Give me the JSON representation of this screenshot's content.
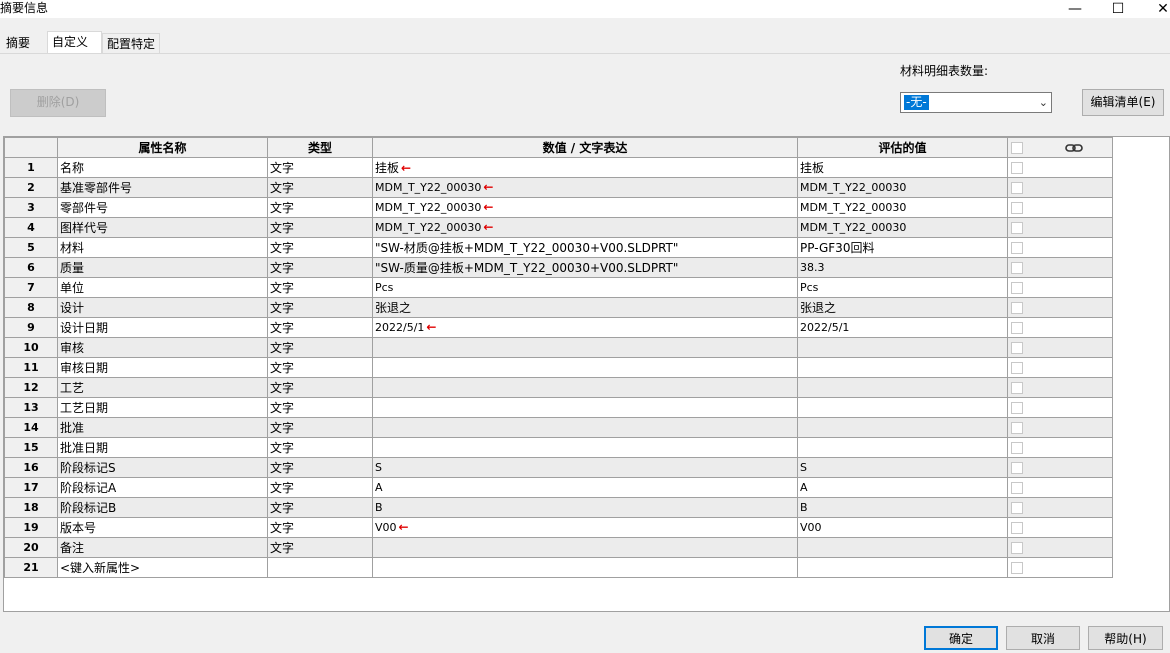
{
  "window": {
    "title": "摘要信息",
    "min": "—",
    "max": "☐",
    "close": "✕"
  },
  "tabs": [
    "摘要",
    "自定义",
    "配置特定"
  ],
  "toolbar": {
    "delete_label": "删除(D)",
    "bom_label": "材料明细表数量:",
    "bom_value": "-无-",
    "edit_list_label": "编辑清单(E)"
  },
  "table": {
    "headers": [
      "属性名称",
      "类型",
      "数值 / 文字表达",
      "评估的值"
    ],
    "link_icon": "link-icon",
    "rows": [
      {
        "num": "1",
        "name": "名称",
        "type": "文字",
        "value": "挂板",
        "eval": "挂板",
        "arrow": true
      },
      {
        "num": "2",
        "name": "基准零部件号",
        "type": "文字",
        "value": "MDM_T_Y22_00030",
        "eval": "MDM_T_Y22_00030",
        "arrow": true
      },
      {
        "num": "3",
        "name": "零部件号",
        "type": "文字",
        "value": "MDM_T_Y22_00030",
        "eval": "MDM_T_Y22_00030",
        "arrow": true
      },
      {
        "num": "4",
        "name": "图样代号",
        "type": "文字",
        "value": "MDM_T_Y22_00030",
        "eval": "MDM_T_Y22_00030",
        "arrow": true
      },
      {
        "num": "5",
        "name": "材料",
        "type": "文字",
        "value": "\"SW-材质@挂板+MDM_T_Y22_00030+V00.SLDPRT\"",
        "eval": "PP-GF30回料",
        "arrow": false
      },
      {
        "num": "6",
        "name": "质量",
        "type": "文字",
        "value": "\"SW-质量@挂板+MDM_T_Y22_00030+V00.SLDPRT\"",
        "eval": "38.3",
        "arrow": false
      },
      {
        "num": "7",
        "name": "单位",
        "type": "文字",
        "value": "Pcs",
        "eval": "Pcs",
        "arrow": false
      },
      {
        "num": "8",
        "name": "设计",
        "type": "文字",
        "value": "张退之",
        "eval": "张退之",
        "arrow": false
      },
      {
        "num": "9",
        "name": "设计日期",
        "type": "文字",
        "value": "2022/5/1",
        "eval": "2022/5/1",
        "arrow": true
      },
      {
        "num": "10",
        "name": "审核",
        "type": "文字",
        "value": "",
        "eval": "",
        "arrow": false
      },
      {
        "num": "11",
        "name": "审核日期",
        "type": "文字",
        "value": "",
        "eval": "",
        "arrow": false
      },
      {
        "num": "12",
        "name": "工艺",
        "type": "文字",
        "value": "",
        "eval": "",
        "arrow": false
      },
      {
        "num": "13",
        "name": "工艺日期",
        "type": "文字",
        "value": "",
        "eval": "",
        "arrow": false
      },
      {
        "num": "14",
        "name": "批准",
        "type": "文字",
        "value": "",
        "eval": "",
        "arrow": false
      },
      {
        "num": "15",
        "name": "批准日期",
        "type": "文字",
        "value": "",
        "eval": "",
        "arrow": false
      },
      {
        "num": "16",
        "name": "阶段标记S",
        "type": "文字",
        "value": "S",
        "eval": "S",
        "arrow": false
      },
      {
        "num": "17",
        "name": "阶段标记A",
        "type": "文字",
        "value": "A",
        "eval": "A",
        "arrow": false
      },
      {
        "num": "18",
        "name": "阶段标记B",
        "type": "文字",
        "value": "B",
        "eval": "B",
        "arrow": false
      },
      {
        "num": "19",
        "name": "版本号",
        "type": "文字",
        "value": "V00",
        "eval": "V00",
        "arrow": true
      },
      {
        "num": "20",
        "name": "备注",
        "type": "文字",
        "value": "",
        "eval": "",
        "arrow": false
      },
      {
        "num": "21",
        "name": "<键入新属性>",
        "type": "",
        "value": "",
        "eval": "",
        "arrow": false
      }
    ]
  },
  "footer": {
    "ok": "确定",
    "cancel": "取消",
    "help": "帮助(H)"
  },
  "colors": {
    "accent": "#0078d7",
    "annotation_arrow": "#e00000"
  }
}
